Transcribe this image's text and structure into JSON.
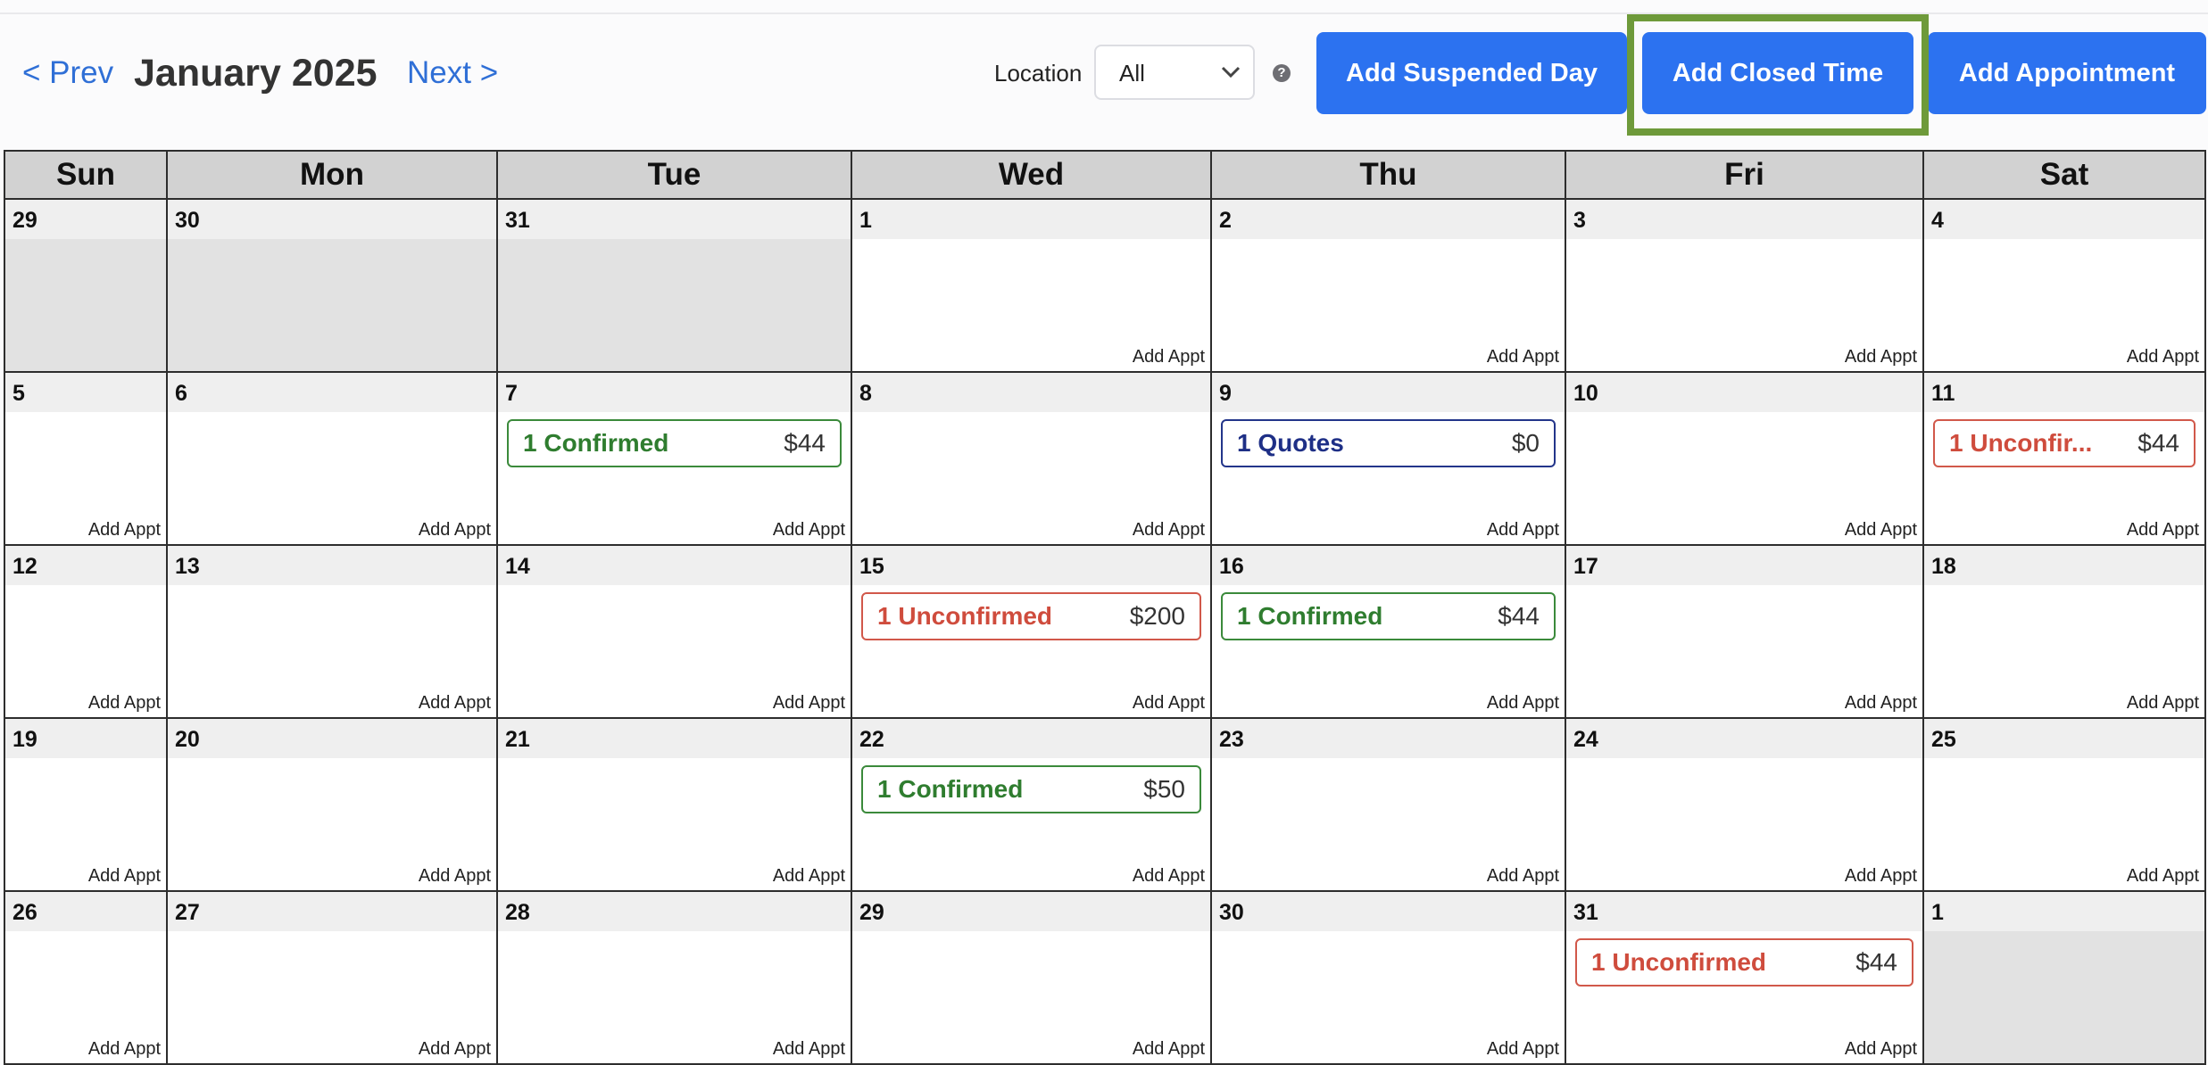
{
  "header": {
    "prev": "< Prev",
    "title": "January 2025",
    "next": "Next >",
    "location_label": "Location",
    "location_value": "All",
    "help": "?",
    "btn_suspended": "Add Suspended Day",
    "btn_closed": "Add Closed Time",
    "btn_appointment": "Add Appointment"
  },
  "calendar": {
    "add_label": "Add Appt",
    "days_of_week": [
      "Sun",
      "Mon",
      "Tue",
      "Wed",
      "Thu",
      "Fri",
      "Sat"
    ],
    "weeks": [
      [
        {
          "day": "29",
          "out": true
        },
        {
          "day": "30",
          "out": true
        },
        {
          "day": "31",
          "out": true
        },
        {
          "day": "1"
        },
        {
          "day": "2"
        },
        {
          "day": "3"
        },
        {
          "day": "4"
        }
      ],
      [
        {
          "day": "5"
        },
        {
          "day": "6"
        },
        {
          "day": "7",
          "event": {
            "label": "1 Confirmed",
            "amount": "$44",
            "status": "green"
          }
        },
        {
          "day": "8"
        },
        {
          "day": "9",
          "event": {
            "label": "1 Quotes",
            "amount": "$0",
            "status": "blue"
          }
        },
        {
          "day": "10"
        },
        {
          "day": "11",
          "event": {
            "label": "1 Unconfir...",
            "amount": "$44",
            "status": "red"
          }
        }
      ],
      [
        {
          "day": "12"
        },
        {
          "day": "13"
        },
        {
          "day": "14"
        },
        {
          "day": "15",
          "event": {
            "label": "1 Unconfirmed",
            "amount": "$200",
            "status": "red"
          }
        },
        {
          "day": "16",
          "event": {
            "label": "1 Confirmed",
            "amount": "$44",
            "status": "green"
          }
        },
        {
          "day": "17"
        },
        {
          "day": "18"
        }
      ],
      [
        {
          "day": "19"
        },
        {
          "day": "20"
        },
        {
          "day": "21"
        },
        {
          "day": "22",
          "event": {
            "label": "1 Confirmed",
            "amount": "$50",
            "status": "green"
          }
        },
        {
          "day": "23"
        },
        {
          "day": "24"
        },
        {
          "day": "25"
        }
      ],
      [
        {
          "day": "26"
        },
        {
          "day": "27"
        },
        {
          "day": "28"
        },
        {
          "day": "29"
        },
        {
          "day": "30"
        },
        {
          "day": "31",
          "event": {
            "label": "1 Unconfirmed",
            "amount": "$44",
            "status": "red"
          }
        },
        {
          "day": "1",
          "out": true,
          "noadd": true
        }
      ]
    ]
  }
}
